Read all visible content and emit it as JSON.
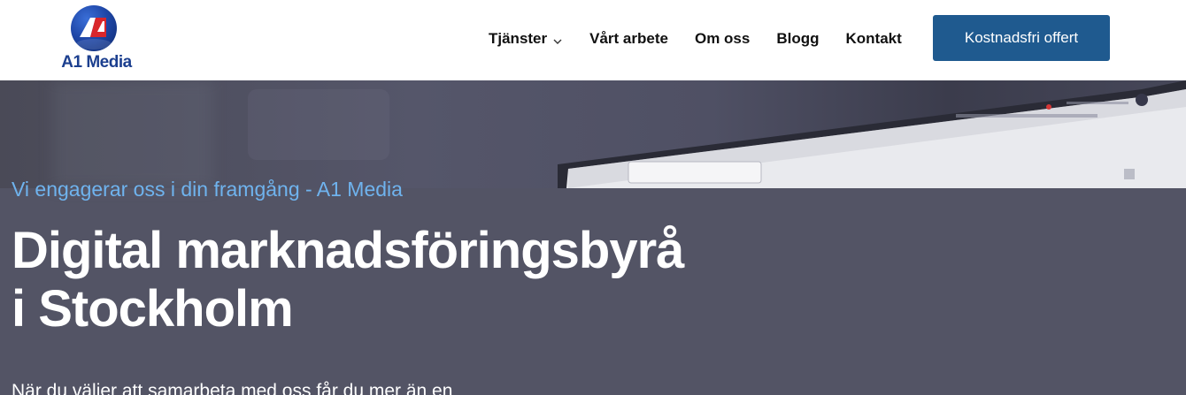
{
  "brand": {
    "logo_text": "A1 Media",
    "colors": {
      "primary": "#1f5a8f",
      "logo_blue": "#1c3f8f",
      "accent_text": "#6fb3ee",
      "hero_bg": "#535465"
    }
  },
  "nav": {
    "items": [
      {
        "label": "Tjänster",
        "icon": "chevron-down-icon"
      },
      {
        "label": "Vårt arbete"
      },
      {
        "label": "Om oss"
      },
      {
        "label": "Blogg"
      },
      {
        "label": "Kontakt"
      }
    ],
    "cta_label": "Kostnadsfri offert"
  },
  "hero": {
    "subtitle": "Vi engagerar oss i din framgång - A1 Media",
    "title_line1": "Digital marknadsföringsbyrå",
    "title_line2": "i Stockholm",
    "text": "När du väljer att samarbeta med oss får du mer än en"
  }
}
